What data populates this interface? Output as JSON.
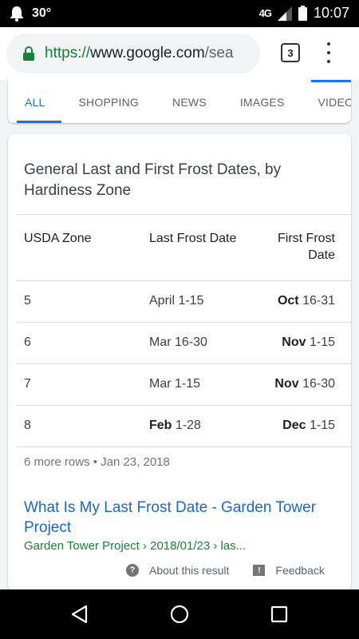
{
  "status_bar": {
    "temperature": "30°",
    "network": "4G",
    "network_sub": "LTE",
    "time": "10:07"
  },
  "browser": {
    "url_scheme": "https://",
    "url_host": "www.google.com",
    "url_rest": "/sea",
    "tab_count": "3"
  },
  "search_tabs": [
    "ALL",
    "SHOPPING",
    "NEWS",
    "IMAGES",
    "VIDEOS"
  ],
  "result_card": {
    "title": "General Last and First Frost Dates, by Hardiness Zone",
    "table": {
      "headers": [
        "USDA Zone",
        "Last Frost Date",
        "First Frost Date"
      ],
      "rows": [
        {
          "zone": "5",
          "last_bold": "",
          "last_rest": "April 1-15",
          "first_bold": "Oct",
          "first_rest": " 16-31"
        },
        {
          "zone": "6",
          "last_bold": "",
          "last_rest": "Mar 16-30",
          "first_bold": "Nov",
          "first_rest": " 1-15"
        },
        {
          "zone": "7",
          "last_bold": "",
          "last_rest": "Mar 1-15",
          "first_bold": "Nov",
          "first_rest": " 16-30"
        },
        {
          "zone": "8",
          "last_bold": "Feb",
          "last_rest": " 1-28",
          "first_bold": "Dec",
          "first_rest": " 1-15"
        }
      ]
    },
    "meta": "6 more rows • Jan 23, 2018",
    "link_title": "What Is My Last Frost Date - Garden Tower Project",
    "cite": "Garden Tower Project › 2018/01/23 › las...",
    "footer": {
      "about": "About this result",
      "feedback": "Feedback"
    }
  },
  "colors": {
    "link": "#1967d2",
    "cite_green": "#188038",
    "active_tab": "#1a73e8"
  }
}
